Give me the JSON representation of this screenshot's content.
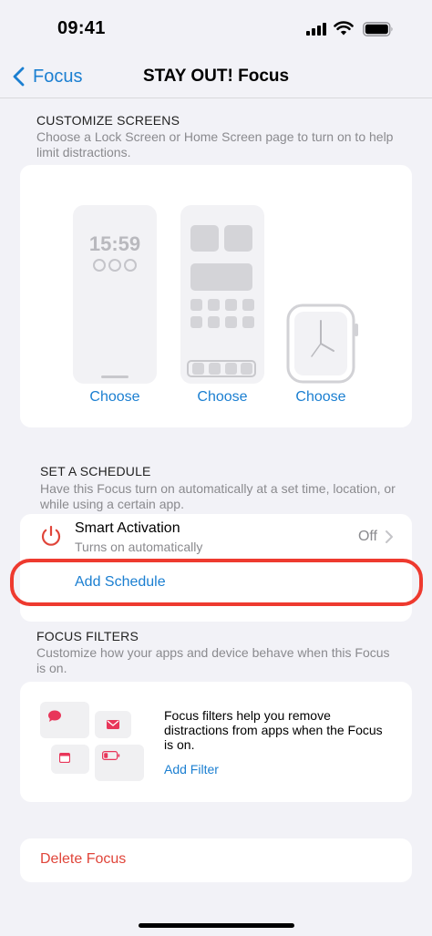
{
  "status_bar": {
    "time": "09:41"
  },
  "nav": {
    "back_label": "Focus",
    "title": "STAY OUT! Focus"
  },
  "customize": {
    "header": "CUSTOMIZE SCREENS",
    "description": "Choose a Lock Screen or Home Screen page to turn on to help limit distractions.",
    "lock_preview_time": "15:59",
    "choose_lock": "Choose",
    "choose_home": "Choose",
    "choose_watch": "Choose"
  },
  "schedule": {
    "header": "SET A SCHEDULE",
    "description": "Have this Focus turn on automatically at a set time, location, or while using a certain app.",
    "smart_title": "Smart Activation",
    "smart_subtitle": "Turns on automatically",
    "smart_value": "Off",
    "add_schedule": "Add Schedule"
  },
  "filters": {
    "header": "FOCUS FILTERS",
    "description": "Customize how your apps and device behave when this Focus is on.",
    "card_text": "Focus filters help you remove distractions from apps when the Focus is on.",
    "add_filter": "Add Filter"
  },
  "delete": {
    "label": "Delete Focus"
  },
  "colors": {
    "accent": "#1b7fd1",
    "destructive": "#e0453a",
    "highlight": "#ee3a2f",
    "filter_icon": "#e8365a"
  }
}
